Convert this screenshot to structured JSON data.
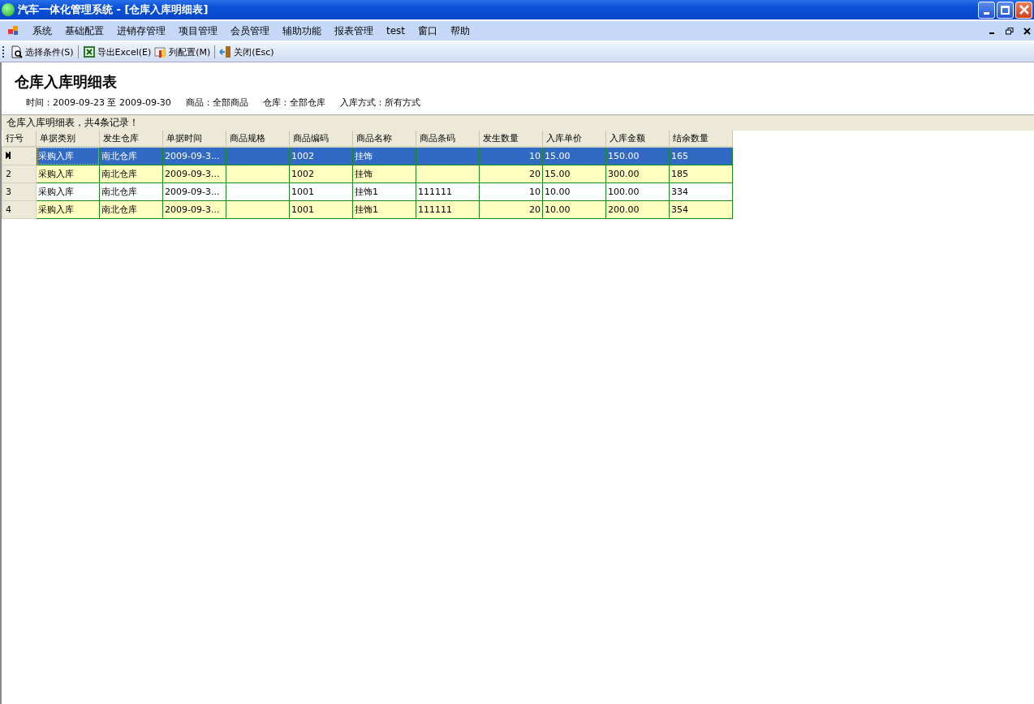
{
  "window": {
    "title": "汽车一体化管理系统 - [仓库入库明细表]"
  },
  "menu": [
    "系统",
    "基础配置",
    "进销存管理",
    "项目管理",
    "会员管理",
    "辅助功能",
    "报表管理",
    "test",
    "窗口",
    "帮助"
  ],
  "toolbar": [
    {
      "kind": "search",
      "label": "选择条件(S)"
    },
    {
      "kind": "excel",
      "label": "导出Excel(E)"
    },
    {
      "kind": "columns",
      "label": "列配置(M)"
    },
    {
      "kind": "close",
      "label": "关闭(Esc)"
    }
  ],
  "report": {
    "title": "仓库入库明细表",
    "filters": [
      "时间：2009-09-23 至 2009-09-30",
      "商品：全部商品",
      "仓库：全部仓库",
      "入库方式：所有方式"
    ]
  },
  "summary": "仓库入库明细表，共4条记录！",
  "table": {
    "row_header_title": "行号",
    "columns": [
      {
        "label": "单据类别",
        "kind": "text"
      },
      {
        "label": "发生仓库",
        "kind": "text"
      },
      {
        "label": "单据时间",
        "kind": "text"
      },
      {
        "label": "商品规格",
        "kind": "text"
      },
      {
        "label": "商品编码",
        "kind": "text"
      },
      {
        "label": "商品名称",
        "kind": "text"
      },
      {
        "label": "商品条码",
        "kind": "text"
      },
      {
        "label": "发生数量",
        "kind": "number"
      },
      {
        "label": "入库单价",
        "kind": "text"
      },
      {
        "label": "入库金额",
        "kind": "text"
      },
      {
        "label": "结余数量",
        "kind": "text"
      }
    ],
    "rows": [
      {
        "selected": true,
        "cells": [
          "采购入库",
          "南北仓库",
          "2009-09-3...",
          "",
          "1002",
          "挂饰",
          "",
          "10",
          "15.00",
          "150.00",
          "165"
        ]
      },
      {
        "selected": false,
        "row_header": "2",
        "cells": [
          "采购入库",
          "南北仓库",
          "2009-09-3...",
          "",
          "1002",
          "挂饰",
          "",
          "20",
          "15.00",
          "300.00",
          "185"
        ]
      },
      {
        "selected": false,
        "row_header": "3",
        "cells": [
          "采购入库",
          "南北仓库",
          "2009-09-3...",
          "",
          "1001",
          "挂饰1",
          "111111",
          "10",
          "10.00",
          "100.00",
          "334"
        ]
      },
      {
        "selected": false,
        "row_header": "4",
        "cells": [
          "采购入库",
          "南北仓库",
          "2009-09-3...",
          "",
          "1001",
          "挂饰1",
          "111111",
          "20",
          "10.00",
          "200.00",
          "354"
        ]
      }
    ]
  }
}
